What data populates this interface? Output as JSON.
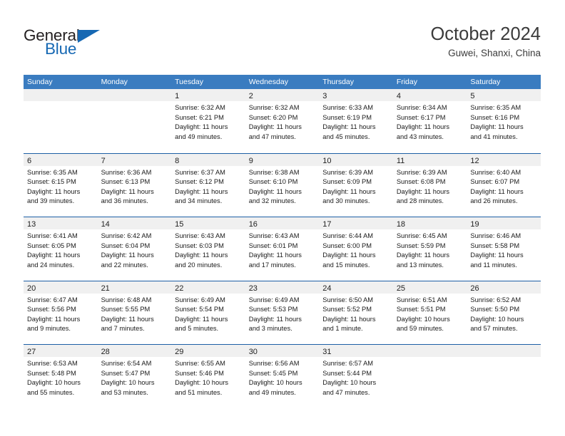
{
  "brand": {
    "name_top": "General",
    "name_bottom": "Blue",
    "accent_color": "#1668b3"
  },
  "header": {
    "title": "October 2024",
    "subtitle": "Guwei, Shanxi, China"
  },
  "theme": {
    "header_bar_color": "#3a7cc0",
    "row_divider_color": "#1d5fa5",
    "day_band_color": "#f0f0f0",
    "text_color": "#1a1a1a"
  },
  "weekday_headers": [
    "Sunday",
    "Monday",
    "Tuesday",
    "Wednesday",
    "Thursday",
    "Friday",
    "Saturday"
  ],
  "weeks": [
    [
      {
        "day": "",
        "lines": []
      },
      {
        "day": "",
        "lines": []
      },
      {
        "day": "1",
        "lines": [
          "Sunrise: 6:32 AM",
          "Sunset: 6:21 PM",
          "Daylight: 11 hours",
          "and 49 minutes."
        ]
      },
      {
        "day": "2",
        "lines": [
          "Sunrise: 6:32 AM",
          "Sunset: 6:20 PM",
          "Daylight: 11 hours",
          "and 47 minutes."
        ]
      },
      {
        "day": "3",
        "lines": [
          "Sunrise: 6:33 AM",
          "Sunset: 6:19 PM",
          "Daylight: 11 hours",
          "and 45 minutes."
        ]
      },
      {
        "day": "4",
        "lines": [
          "Sunrise: 6:34 AM",
          "Sunset: 6:17 PM",
          "Daylight: 11 hours",
          "and 43 minutes."
        ]
      },
      {
        "day": "5",
        "lines": [
          "Sunrise: 6:35 AM",
          "Sunset: 6:16 PM",
          "Daylight: 11 hours",
          "and 41 minutes."
        ]
      }
    ],
    [
      {
        "day": "6",
        "lines": [
          "Sunrise: 6:35 AM",
          "Sunset: 6:15 PM",
          "Daylight: 11 hours",
          "and 39 minutes."
        ]
      },
      {
        "day": "7",
        "lines": [
          "Sunrise: 6:36 AM",
          "Sunset: 6:13 PM",
          "Daylight: 11 hours",
          "and 36 minutes."
        ]
      },
      {
        "day": "8",
        "lines": [
          "Sunrise: 6:37 AM",
          "Sunset: 6:12 PM",
          "Daylight: 11 hours",
          "and 34 minutes."
        ]
      },
      {
        "day": "9",
        "lines": [
          "Sunrise: 6:38 AM",
          "Sunset: 6:10 PM",
          "Daylight: 11 hours",
          "and 32 minutes."
        ]
      },
      {
        "day": "10",
        "lines": [
          "Sunrise: 6:39 AM",
          "Sunset: 6:09 PM",
          "Daylight: 11 hours",
          "and 30 minutes."
        ]
      },
      {
        "day": "11",
        "lines": [
          "Sunrise: 6:39 AM",
          "Sunset: 6:08 PM",
          "Daylight: 11 hours",
          "and 28 minutes."
        ]
      },
      {
        "day": "12",
        "lines": [
          "Sunrise: 6:40 AM",
          "Sunset: 6:07 PM",
          "Daylight: 11 hours",
          "and 26 minutes."
        ]
      }
    ],
    [
      {
        "day": "13",
        "lines": [
          "Sunrise: 6:41 AM",
          "Sunset: 6:05 PM",
          "Daylight: 11 hours",
          "and 24 minutes."
        ]
      },
      {
        "day": "14",
        "lines": [
          "Sunrise: 6:42 AM",
          "Sunset: 6:04 PM",
          "Daylight: 11 hours",
          "and 22 minutes."
        ]
      },
      {
        "day": "15",
        "lines": [
          "Sunrise: 6:43 AM",
          "Sunset: 6:03 PM",
          "Daylight: 11 hours",
          "and 20 minutes."
        ]
      },
      {
        "day": "16",
        "lines": [
          "Sunrise: 6:43 AM",
          "Sunset: 6:01 PM",
          "Daylight: 11 hours",
          "and 17 minutes."
        ]
      },
      {
        "day": "17",
        "lines": [
          "Sunrise: 6:44 AM",
          "Sunset: 6:00 PM",
          "Daylight: 11 hours",
          "and 15 minutes."
        ]
      },
      {
        "day": "18",
        "lines": [
          "Sunrise: 6:45 AM",
          "Sunset: 5:59 PM",
          "Daylight: 11 hours",
          "and 13 minutes."
        ]
      },
      {
        "day": "19",
        "lines": [
          "Sunrise: 6:46 AM",
          "Sunset: 5:58 PM",
          "Daylight: 11 hours",
          "and 11 minutes."
        ]
      }
    ],
    [
      {
        "day": "20",
        "lines": [
          "Sunrise: 6:47 AM",
          "Sunset: 5:56 PM",
          "Daylight: 11 hours",
          "and 9 minutes."
        ]
      },
      {
        "day": "21",
        "lines": [
          "Sunrise: 6:48 AM",
          "Sunset: 5:55 PM",
          "Daylight: 11 hours",
          "and 7 minutes."
        ]
      },
      {
        "day": "22",
        "lines": [
          "Sunrise: 6:49 AM",
          "Sunset: 5:54 PM",
          "Daylight: 11 hours",
          "and 5 minutes."
        ]
      },
      {
        "day": "23",
        "lines": [
          "Sunrise: 6:49 AM",
          "Sunset: 5:53 PM",
          "Daylight: 11 hours",
          "and 3 minutes."
        ]
      },
      {
        "day": "24",
        "lines": [
          "Sunrise: 6:50 AM",
          "Sunset: 5:52 PM",
          "Daylight: 11 hours",
          "and 1 minute."
        ]
      },
      {
        "day": "25",
        "lines": [
          "Sunrise: 6:51 AM",
          "Sunset: 5:51 PM",
          "Daylight: 10 hours",
          "and 59 minutes."
        ]
      },
      {
        "day": "26",
        "lines": [
          "Sunrise: 6:52 AM",
          "Sunset: 5:50 PM",
          "Daylight: 10 hours",
          "and 57 minutes."
        ]
      }
    ],
    [
      {
        "day": "27",
        "lines": [
          "Sunrise: 6:53 AM",
          "Sunset: 5:48 PM",
          "Daylight: 10 hours",
          "and 55 minutes."
        ]
      },
      {
        "day": "28",
        "lines": [
          "Sunrise: 6:54 AM",
          "Sunset: 5:47 PM",
          "Daylight: 10 hours",
          "and 53 minutes."
        ]
      },
      {
        "day": "29",
        "lines": [
          "Sunrise: 6:55 AM",
          "Sunset: 5:46 PM",
          "Daylight: 10 hours",
          "and 51 minutes."
        ]
      },
      {
        "day": "30",
        "lines": [
          "Sunrise: 6:56 AM",
          "Sunset: 5:45 PM",
          "Daylight: 10 hours",
          "and 49 minutes."
        ]
      },
      {
        "day": "31",
        "lines": [
          "Sunrise: 6:57 AM",
          "Sunset: 5:44 PM",
          "Daylight: 10 hours",
          "and 47 minutes."
        ]
      },
      {
        "day": "",
        "lines": []
      },
      {
        "day": "",
        "lines": []
      }
    ]
  ]
}
